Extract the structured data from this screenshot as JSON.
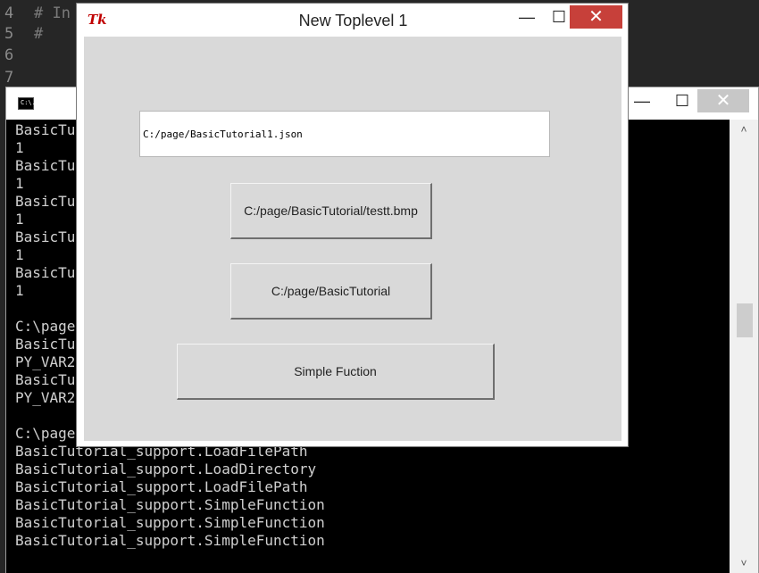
{
  "editor": {
    "lines": [
      {
        "num": "4",
        "code": "# In"
      },
      {
        "num": "5",
        "code": "#"
      },
      {
        "num": "6",
        "code": ""
      },
      {
        "num": "7",
        "code": ""
      }
    ]
  },
  "console": {
    "icon_label": "C:\\.",
    "minimize": "—",
    "maximize": "☐",
    "close": "✕",
    "scroll_up": "˄",
    "scroll_down": "˅",
    "lines": [
      "BasicTu",
      "1",
      "BasicTu",
      "1",
      "BasicTu",
      "1",
      "BasicTu",
      "1",
      "BasicTu",
      "1",
      "",
      "C:\\page",
      "BasicTu",
      "PY_VAR2",
      "BasicTu",
      "PY_VAR2",
      "",
      "C:\\page",
      "BasicTutorial_support.LoadFilePath",
      "BasicTutorial_support.LoadDirectory",
      "BasicTutorial_support.LoadFilePath",
      "BasicTutorial_support.SimpleFunction",
      "BasicTutorial_support.SimpleFunction",
      "BasicTutorial_support.SimpleFunction"
    ]
  },
  "toplevel": {
    "icon_label": "Tk",
    "title": "New Toplevel 1",
    "minimize": "—",
    "maximize": "☐",
    "close": "✕",
    "entry_value": "C:/page/BasicTutorial1.json",
    "button_file": "C:/page/BasicTutorial/testt.bmp",
    "button_dir": "C:/page/BasicTutorial",
    "button_func": "Simple Fuction"
  }
}
